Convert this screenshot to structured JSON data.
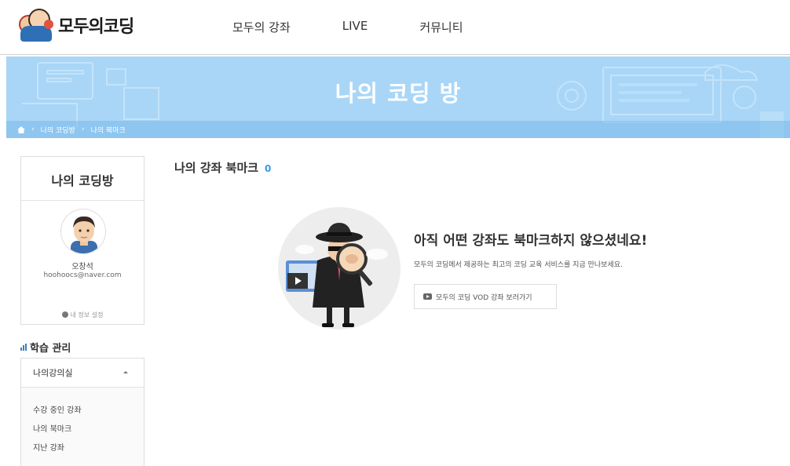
{
  "header": {
    "logo_text": "모두의코딩",
    "nav": [
      "모두의 강좌",
      "LIVE",
      "커뮤니티"
    ]
  },
  "banner": {
    "title": "나의 코딩 방",
    "breadcrumb": [
      "나의 코딩방",
      "나의 북마크"
    ]
  },
  "sidebar": {
    "card_title": "나의 코딩방",
    "user_name": "오창석",
    "user_email": "hoohoocs@naver.com",
    "settings_label": "내 정보 설정",
    "learning_heading": "학습 관리",
    "menu_head": "나의강의실",
    "menu_items": [
      "수강 중인 강좌",
      "나의 북마크",
      "지난 강좌"
    ]
  },
  "main": {
    "title": "나의 강좌 북마크",
    "count": "0",
    "empty_title": "아직 어떤 강좌도 북마크하지 않으셨네요!",
    "empty_sub": "모두의 코딩에서 제공하는 최고의 코딩 교육 서비스를 지금 만나보세요.",
    "vod_button": "모두의 코딩 VOD 강좌 보러가기"
  },
  "colors": {
    "banner": "#a9d6f6",
    "accent": "#3b9be0",
    "text": "#333333"
  }
}
